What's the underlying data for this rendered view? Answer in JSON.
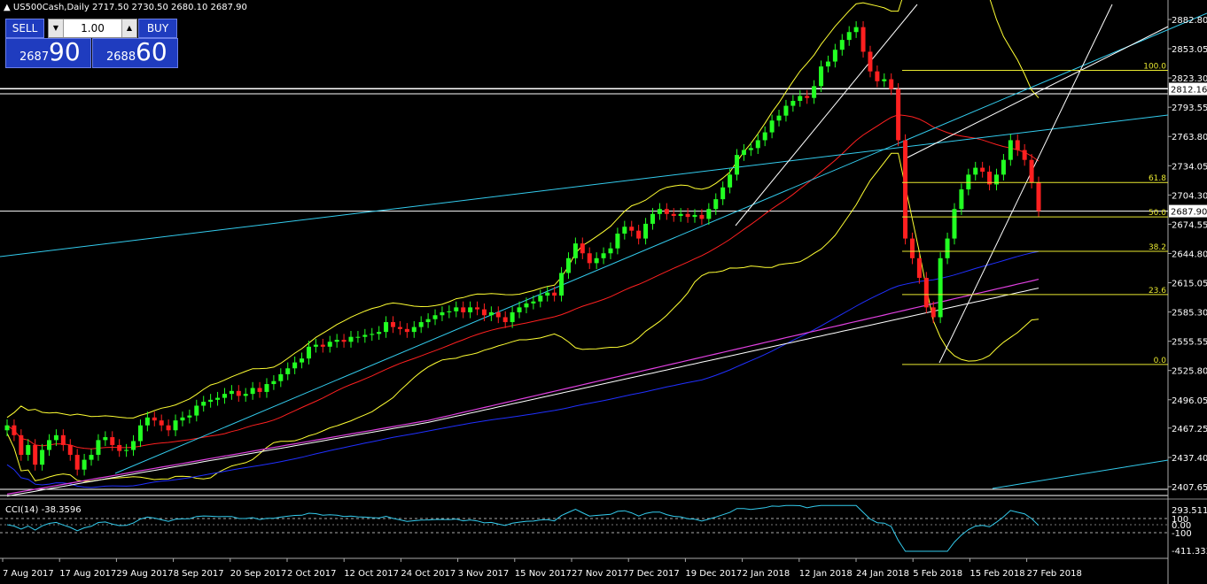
{
  "header": {
    "symbol_line": "US500Cash,Daily  2717.50 2730.50 2680.10 2687.90"
  },
  "trade_panel": {
    "sell_label": "SELL",
    "buy_label": "BUY",
    "lot": "1.00",
    "sell_small": "2687",
    "sell_big": "90",
    "buy_small": "2688",
    "buy_big": "60"
  },
  "price_axis": {
    "labels": [
      "2882.80",
      "2853.05",
      "2823.30",
      "2793.55",
      "2763.80",
      "2734.05",
      "2704.30",
      "2674.55",
      "2644.80",
      "2615.05",
      "2585.30",
      "2555.55",
      "2525.80",
      "2496.05",
      "2467.25",
      "2437.40",
      "2407.65"
    ],
    "current_price": "2687.90",
    "hline_price": "2812.16"
  },
  "indicator": {
    "label": "CCI(14) -38.3596",
    "axis_labels": [
      "293.5115",
      "100",
      "0.00",
      "-100",
      "-411.3332"
    ]
  },
  "time_axis": {
    "labels": [
      "7 Aug 2017",
      "17 Aug 2017",
      "29 Aug 2017",
      "8 Sep 2017",
      "20 Sep 2017",
      "2 Oct 2017",
      "12 Oct 2017",
      "24 Oct 2017",
      "3 Nov 2017",
      "15 Nov 2017",
      "27 Nov 2017",
      "7 Dec 2017",
      "19 Dec 2017",
      "2 Jan 2018",
      "12 Jan 2018",
      "24 Jan 2018",
      "5 Feb 2018",
      "15 Feb 2018",
      "27 Feb 2018"
    ]
  },
  "fibonacci": {
    "levels": [
      "100.0",
      "61.8",
      "50.0",
      "38.2",
      "23.6",
      "0.0"
    ]
  },
  "chart_data": {
    "type": "candlestick",
    "title": "US500Cash,Daily",
    "last_bar": {
      "open": 2717.5,
      "high": 2730.5,
      "low": 2680.1,
      "close": 2687.9
    },
    "ylim": [
      2400,
      2900
    ],
    "closes": [
      2470,
      2460,
      2440,
      2450,
      2430,
      2445,
      2455,
      2460,
      2450,
      2440,
      2425,
      2435,
      2440,
      2455,
      2458,
      2450,
      2444,
      2445,
      2454,
      2470,
      2478,
      2475,
      2470,
      2465,
      2475,
      2478,
      2480,
      2490,
      2494,
      2496,
      2498,
      2502,
      2505,
      2500,
      2502,
      2508,
      2504,
      2512,
      2515,
      2522,
      2528,
      2534,
      2538,
      2550,
      2552,
      2550,
      2555,
      2557,
      2555,
      2560,
      2560,
      2562,
      2563,
      2565,
      2575,
      2570,
      2568,
      2565,
      2570,
      2575,
      2578,
      2582,
      2585,
      2586,
      2590,
      2585,
      2590,
      2588,
      2582,
      2585,
      2580,
      2575,
      2585,
      2590,
      2594,
      2596,
      2602,
      2605,
      2602,
      2625,
      2640,
      2655,
      2645,
      2635,
      2640,
      2645,
      2650,
      2665,
      2672,
      2668,
      2660,
      2675,
      2685,
      2690,
      2685,
      2683,
      2685,
      2682,
      2684,
      2680,
      2690,
      2700,
      2712,
      2725,
      2745,
      2750,
      2752,
      2760,
      2768,
      2780,
      2785,
      2795,
      2800,
      2805,
      2803,
      2815,
      2835,
      2840,
      2852,
      2862,
      2870,
      2875,
      2850,
      2830,
      2820,
      2822,
      2812,
      2760,
      2660,
      2640,
      2620,
      2590,
      2580,
      2640,
      2660,
      2690,
      2710,
      2725,
      2732,
      2728,
      2715,
      2725,
      2740,
      2760,
      2750,
      2740,
      2717,
      2688
    ],
    "fib_levels": {
      "100.0": 2831,
      "61.8": 2717,
      "50.0": 2682,
      "38.2": 2647,
      "23.6": 2603,
      "0.0": 2532
    },
    "cci_last": -38.3596
  }
}
